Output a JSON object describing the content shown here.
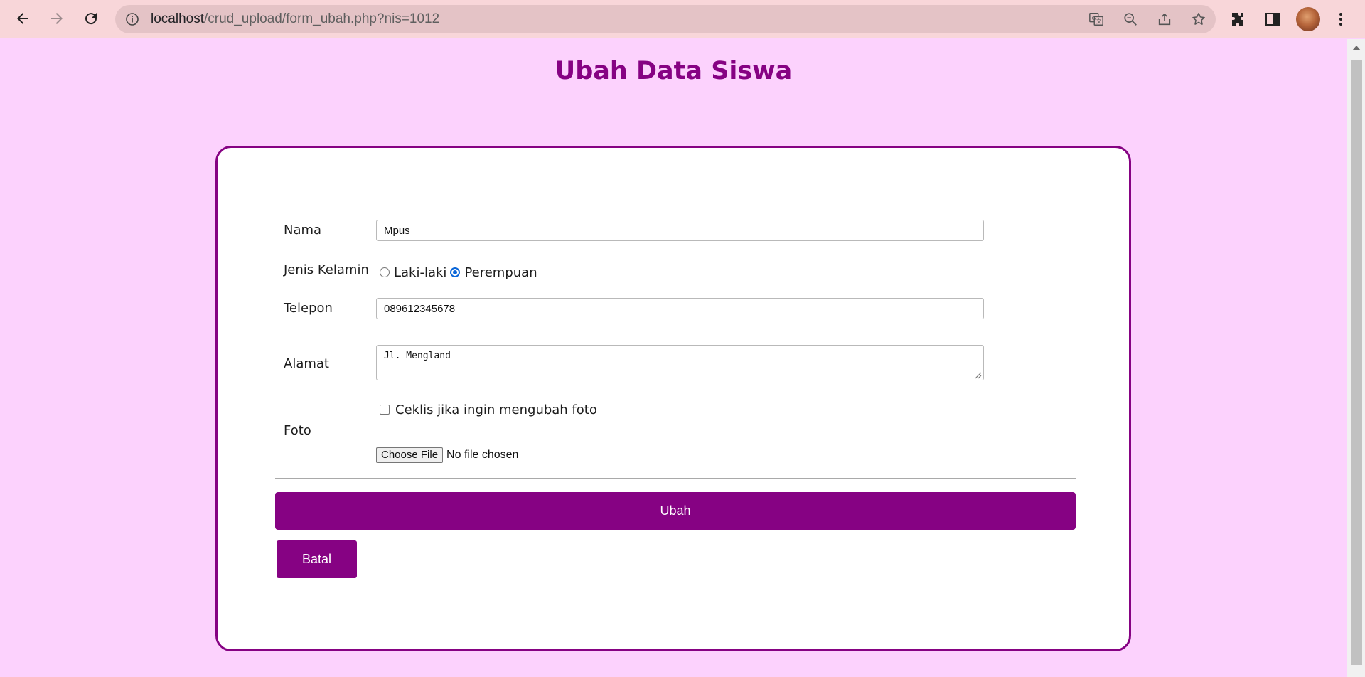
{
  "browser": {
    "url_host": "localhost",
    "url_path": "/crud_upload/form_ubah.php?nis=1012"
  },
  "page": {
    "title": "Ubah Data Siswa"
  },
  "form": {
    "nama": {
      "label": "Nama",
      "value": "Mpus"
    },
    "jenis_kelamin": {
      "label": "Jenis Kelamin",
      "options": [
        {
          "label": "Laki-laki",
          "checked": false
        },
        {
          "label": "Perempuan",
          "checked": true
        }
      ]
    },
    "telepon": {
      "label": "Telepon",
      "value": "089612345678"
    },
    "alamat": {
      "label": "Alamat",
      "value": "Jl. Mengland"
    },
    "foto": {
      "label": "Foto",
      "checkbox_label": "Ceklis jika ingin mengubah foto",
      "file_button": "Choose File",
      "file_status": "No file chosen"
    },
    "submit_label": "Ubah",
    "cancel_label": "Batal"
  },
  "colors": {
    "accent": "#860283",
    "background": "#fcd2fd",
    "browser_bar": "#f8d6d9"
  }
}
